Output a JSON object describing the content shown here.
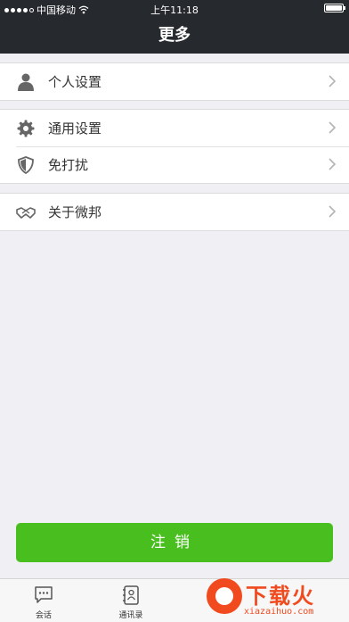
{
  "status_bar": {
    "carrier": "中国移动",
    "time": "上午11:18"
  },
  "nav": {
    "title": "更多"
  },
  "groups": [
    {
      "items": [
        {
          "label": "个人设置",
          "icon": "person-icon"
        }
      ]
    },
    {
      "items": [
        {
          "label": "通用设置",
          "icon": "gear-icon"
        },
        {
          "label": "免打扰",
          "icon": "shield-icon"
        }
      ]
    },
    {
      "items": [
        {
          "label": "关于微邦",
          "icon": "handshake-icon"
        }
      ]
    }
  ],
  "logout_label": "注销",
  "tabbar": {
    "tabs": [
      {
        "label": "会话",
        "icon": "chat-bubble-icon"
      },
      {
        "label": "通讯录",
        "icon": "contacts-book-icon"
      }
    ]
  },
  "watermark": {
    "title": "下载火",
    "url": "xiazaihuo.com"
  },
  "colors": {
    "nav_bg": "#262a2e",
    "accent": "#49bf1f",
    "page_bg": "#efeff4",
    "watermark": "#f04a1e"
  }
}
